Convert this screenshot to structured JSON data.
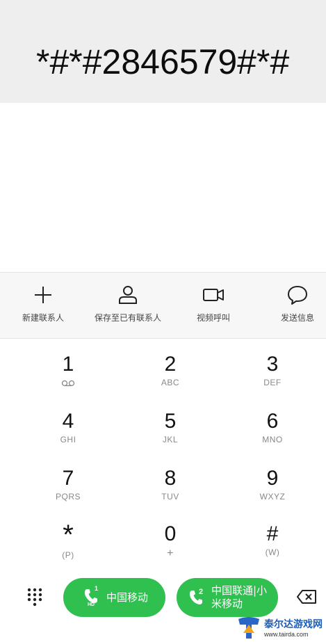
{
  "display": {
    "number": "*#*#2846579#*#"
  },
  "actions": [
    {
      "label": "新建联系人",
      "icon": "plus-icon"
    },
    {
      "label": "保存至已有联系人",
      "icon": "person-icon"
    },
    {
      "label": "视频呼叫",
      "icon": "video-camera-icon"
    },
    {
      "label": "发送信息",
      "icon": "message-bubble-icon"
    }
  ],
  "keys": [
    {
      "digit": "1",
      "sub": ""
    },
    {
      "digit": "2",
      "sub": "ABC"
    },
    {
      "digit": "3",
      "sub": "DEF"
    },
    {
      "digit": "4",
      "sub": "GHI"
    },
    {
      "digit": "5",
      "sub": "JKL"
    },
    {
      "digit": "6",
      "sub": "MNO"
    },
    {
      "digit": "7",
      "sub": "PQRS"
    },
    {
      "digit": "8",
      "sub": "TUV"
    },
    {
      "digit": "9",
      "sub": "WXYZ"
    },
    {
      "digit": "*",
      "sub": "(P)"
    },
    {
      "digit": "0",
      "sub": "+"
    },
    {
      "digit": "#",
      "sub": "(W)"
    }
  ],
  "call": {
    "sim1": {
      "slot": "1",
      "hd": "HD",
      "label": "中国移动"
    },
    "sim2": {
      "slot": "2",
      "label_line1": "中国联通|小",
      "label_line2": "米移动"
    }
  },
  "watermark": {
    "name": "泰尔达游戏网",
    "url": "www.tairda.com"
  },
  "colors": {
    "call_green": "#2fc050",
    "display_bg": "#eeeeee",
    "action_bg": "#f7f7f7"
  }
}
